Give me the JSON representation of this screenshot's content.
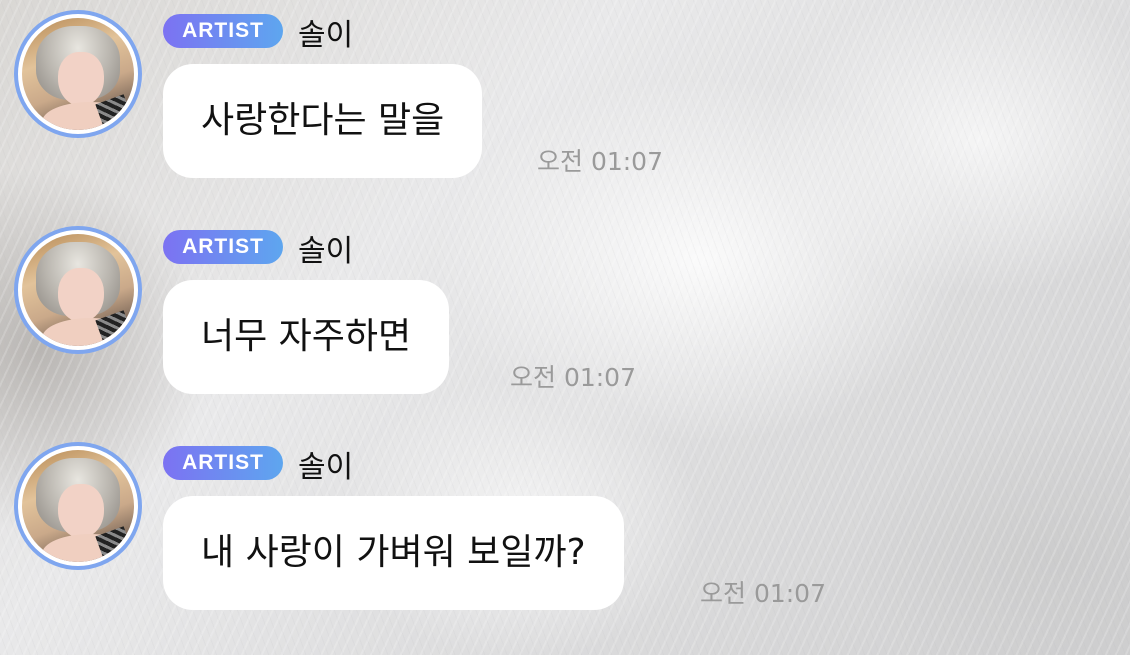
{
  "chat": {
    "messages": [
      {
        "badge": "ARTIST",
        "sender": "솔이",
        "text": "사랑한다는 말을",
        "time": "오전 01:07"
      },
      {
        "badge": "ARTIST",
        "sender": "솔이",
        "text": "너무 자주하면",
        "time": "오전 01:07"
      },
      {
        "badge": "ARTIST",
        "sender": "솔이",
        "text": "내 사랑이 가벼워 보일까?",
        "time": "오전 01:07"
      }
    ]
  },
  "colors": {
    "badge_gradient_start": "#7c72f2",
    "badge_gradient_end": "#5ea6ef",
    "avatar_ring": "#7fa6ef",
    "bubble": "#ffffff",
    "time": "#9a9a9a"
  }
}
